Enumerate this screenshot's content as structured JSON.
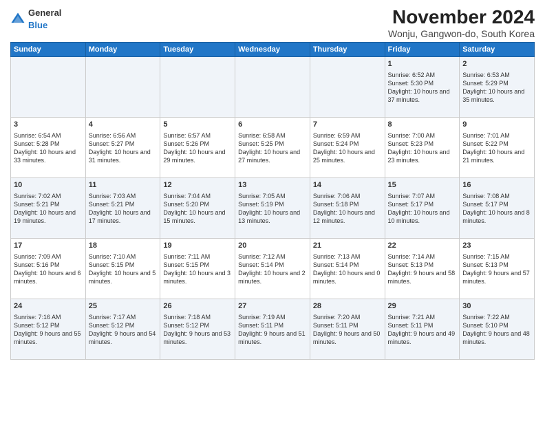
{
  "header": {
    "logo_general": "General",
    "logo_blue": "Blue",
    "month_title": "November 2024",
    "subtitle": "Wonju, Gangwon-do, South Korea"
  },
  "columns": [
    "Sunday",
    "Monday",
    "Tuesday",
    "Wednesday",
    "Thursday",
    "Friday",
    "Saturday"
  ],
  "weeks": [
    {
      "days": [
        {
          "num": "",
          "content": ""
        },
        {
          "num": "",
          "content": ""
        },
        {
          "num": "",
          "content": ""
        },
        {
          "num": "",
          "content": ""
        },
        {
          "num": "",
          "content": ""
        },
        {
          "num": "1",
          "content": "Sunrise: 6:52 AM\nSunset: 5:30 PM\nDaylight: 10 hours and 37 minutes."
        },
        {
          "num": "2",
          "content": "Sunrise: 6:53 AM\nSunset: 5:29 PM\nDaylight: 10 hours and 35 minutes."
        }
      ]
    },
    {
      "days": [
        {
          "num": "3",
          "content": "Sunrise: 6:54 AM\nSunset: 5:28 PM\nDaylight: 10 hours and 33 minutes."
        },
        {
          "num": "4",
          "content": "Sunrise: 6:56 AM\nSunset: 5:27 PM\nDaylight: 10 hours and 31 minutes."
        },
        {
          "num": "5",
          "content": "Sunrise: 6:57 AM\nSunset: 5:26 PM\nDaylight: 10 hours and 29 minutes."
        },
        {
          "num": "6",
          "content": "Sunrise: 6:58 AM\nSunset: 5:25 PM\nDaylight: 10 hours and 27 minutes."
        },
        {
          "num": "7",
          "content": "Sunrise: 6:59 AM\nSunset: 5:24 PM\nDaylight: 10 hours and 25 minutes."
        },
        {
          "num": "8",
          "content": "Sunrise: 7:00 AM\nSunset: 5:23 PM\nDaylight: 10 hours and 23 minutes."
        },
        {
          "num": "9",
          "content": "Sunrise: 7:01 AM\nSunset: 5:22 PM\nDaylight: 10 hours and 21 minutes."
        }
      ]
    },
    {
      "days": [
        {
          "num": "10",
          "content": "Sunrise: 7:02 AM\nSunset: 5:21 PM\nDaylight: 10 hours and 19 minutes."
        },
        {
          "num": "11",
          "content": "Sunrise: 7:03 AM\nSunset: 5:21 PM\nDaylight: 10 hours and 17 minutes."
        },
        {
          "num": "12",
          "content": "Sunrise: 7:04 AM\nSunset: 5:20 PM\nDaylight: 10 hours and 15 minutes."
        },
        {
          "num": "13",
          "content": "Sunrise: 7:05 AM\nSunset: 5:19 PM\nDaylight: 10 hours and 13 minutes."
        },
        {
          "num": "14",
          "content": "Sunrise: 7:06 AM\nSunset: 5:18 PM\nDaylight: 10 hours and 12 minutes."
        },
        {
          "num": "15",
          "content": "Sunrise: 7:07 AM\nSunset: 5:17 PM\nDaylight: 10 hours and 10 minutes."
        },
        {
          "num": "16",
          "content": "Sunrise: 7:08 AM\nSunset: 5:17 PM\nDaylight: 10 hours and 8 minutes."
        }
      ]
    },
    {
      "days": [
        {
          "num": "17",
          "content": "Sunrise: 7:09 AM\nSunset: 5:16 PM\nDaylight: 10 hours and 6 minutes."
        },
        {
          "num": "18",
          "content": "Sunrise: 7:10 AM\nSunset: 5:15 PM\nDaylight: 10 hours and 5 minutes."
        },
        {
          "num": "19",
          "content": "Sunrise: 7:11 AM\nSunset: 5:15 PM\nDaylight: 10 hours and 3 minutes."
        },
        {
          "num": "20",
          "content": "Sunrise: 7:12 AM\nSunset: 5:14 PM\nDaylight: 10 hours and 2 minutes."
        },
        {
          "num": "21",
          "content": "Sunrise: 7:13 AM\nSunset: 5:14 PM\nDaylight: 10 hours and 0 minutes."
        },
        {
          "num": "22",
          "content": "Sunrise: 7:14 AM\nSunset: 5:13 PM\nDaylight: 9 hours and 58 minutes."
        },
        {
          "num": "23",
          "content": "Sunrise: 7:15 AM\nSunset: 5:13 PM\nDaylight: 9 hours and 57 minutes."
        }
      ]
    },
    {
      "days": [
        {
          "num": "24",
          "content": "Sunrise: 7:16 AM\nSunset: 5:12 PM\nDaylight: 9 hours and 55 minutes."
        },
        {
          "num": "25",
          "content": "Sunrise: 7:17 AM\nSunset: 5:12 PM\nDaylight: 9 hours and 54 minutes."
        },
        {
          "num": "26",
          "content": "Sunrise: 7:18 AM\nSunset: 5:12 PM\nDaylight: 9 hours and 53 minutes."
        },
        {
          "num": "27",
          "content": "Sunrise: 7:19 AM\nSunset: 5:11 PM\nDaylight: 9 hours and 51 minutes."
        },
        {
          "num": "28",
          "content": "Sunrise: 7:20 AM\nSunset: 5:11 PM\nDaylight: 9 hours and 50 minutes."
        },
        {
          "num": "29",
          "content": "Sunrise: 7:21 AM\nSunset: 5:11 PM\nDaylight: 9 hours and 49 minutes."
        },
        {
          "num": "30",
          "content": "Sunrise: 7:22 AM\nSunset: 5:10 PM\nDaylight: 9 hours and 48 minutes."
        }
      ]
    }
  ]
}
